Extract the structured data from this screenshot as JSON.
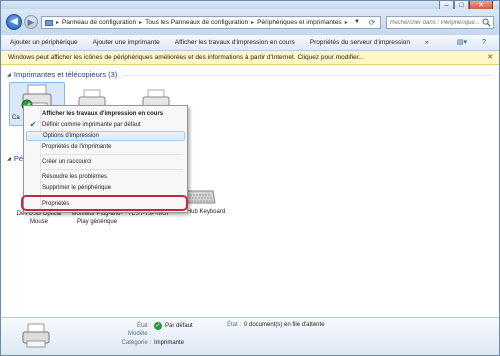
{
  "window": {
    "caption_buttons": [
      "–",
      "□",
      "✕"
    ]
  },
  "address": {
    "crumbs": [
      "Panneau de configuration",
      "Tous les Panneaux de configuration",
      "Périphériques et imprimantes"
    ],
    "search_placeholder": "Rechercher dans : Périphérique..."
  },
  "toolbar": {
    "items": [
      "Ajouter un périphérique",
      "Ajouter une imprimante",
      "Afficher les travaux d'impression en cours",
      "Propriétés du serveur d'impression",
      "»"
    ]
  },
  "infobar": {
    "text": "Windows peut afficher les icônes de périphériques améliorées et des informations à partir d'Internet. Cliquez pour modifier..."
  },
  "groups": {
    "printers": "Imprimantes et télécopieurs (3)",
    "peripherals": "Pé"
  },
  "printer_partial_label": "Ca",
  "devices": [
    {
      "label": "Dell USB Optical Mouse"
    },
    {
      "label": "Moniteur Plug-and-Play générique"
    },
    {
      "label": "TEST-7JP-MUI"
    },
    {
      "label": "USB Hub Keyboard"
    }
  ],
  "context_menu": {
    "items": [
      {
        "label": "Afficher les travaux d'impression en cours",
        "bold": true
      },
      {
        "label": "Définir comme imprimante par défaut",
        "checked": true
      },
      {
        "label": "Options d'impression",
        "hover": true
      },
      {
        "label": "Propriétés de l'imprimante"
      },
      {
        "label": "Créer un raccourci"
      },
      {
        "label": "Résoudre les problèmes"
      },
      {
        "label": "Supprimer le périphérique"
      },
      {
        "label": "Propriétés",
        "highlighted": true
      }
    ]
  },
  "details": {
    "state_key": "État :",
    "state_value": "Par défaut",
    "model_key": "Modèle :",
    "model_value": "",
    "category_key": "Catégorie :",
    "category_value": "Imprimante",
    "state2_key": "État :",
    "state2_value": "0 document(s) en file d'attente"
  },
  "colors": {
    "accent_blue": "#1e3f8b",
    "highlight_ring": "#c42a3c",
    "infobar_bg": "#fff8c4"
  }
}
